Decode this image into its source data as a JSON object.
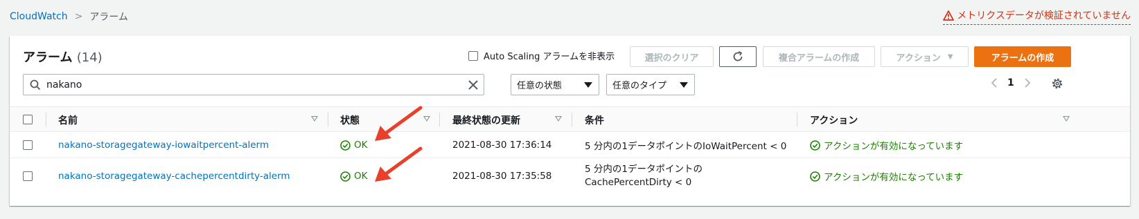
{
  "breadcrumb": {
    "root": "CloudWatch",
    "separator": ">",
    "current": "アラーム"
  },
  "warning": {
    "icon": "warning-triangle-icon",
    "text": "メトリクスデータが検証されていません",
    "color": "#d13212"
  },
  "header": {
    "title": "アラーム",
    "count": "(14)",
    "autoscaling_label": "Auto Scaling アラームを非表示",
    "buttons": {
      "clear_selection": "選択のクリア",
      "refresh_icon": "refresh-icon",
      "create_composite": "複合アラームの作成",
      "actions": "アクション",
      "create_alarm": "アラームの作成"
    }
  },
  "filters": {
    "search_value": "nakano",
    "state_select": "任意の状態",
    "type_select": "任意のタイプ"
  },
  "pagination": {
    "page": "1"
  },
  "table": {
    "columns": [
      "名前",
      "状態",
      "最終状態の更新",
      "条件",
      "アクション"
    ],
    "rows": [
      {
        "name": "nakano-storagegateway-iowaitpercent-alerm",
        "state": "OK",
        "updated": "2021-08-30 17:36:14",
        "condition": "5 分内の1データポイントのIoWaitPercent < 0",
        "actions": "アクションが有効になっています"
      },
      {
        "name": "nakano-storagegateway-cachepercentdirty-alerm",
        "state": "OK",
        "updated": "2021-08-30 17:35:58",
        "condition": "5 分内の1データポイントのCachePercentDirty < 0",
        "actions": "アクションが有効になっています"
      }
    ]
  },
  "colors": {
    "link": "#0073bb",
    "ok": "#1d8102",
    "primary": "#ec7211",
    "annotation_arrow": "#e8402a"
  }
}
